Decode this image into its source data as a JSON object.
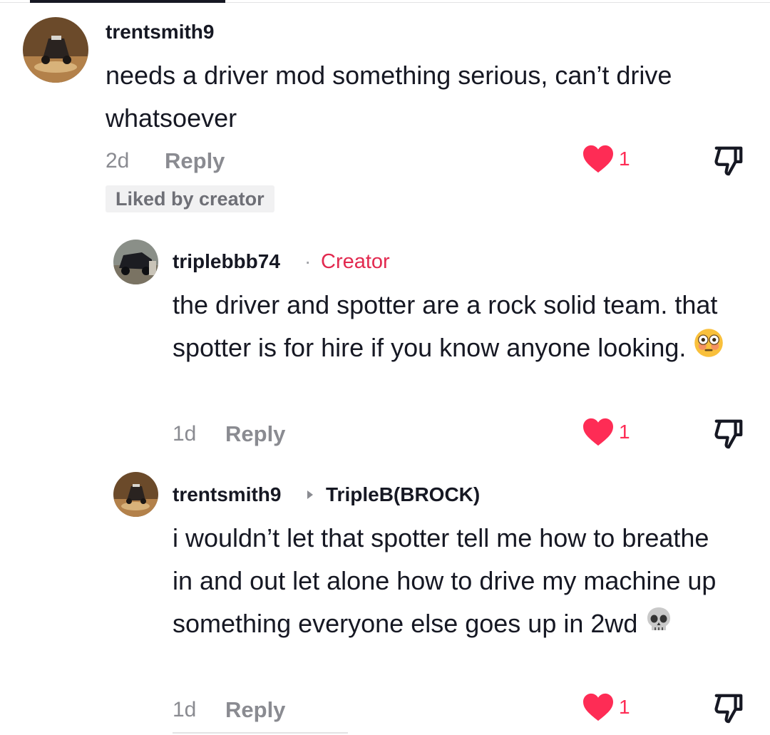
{
  "comments": [
    {
      "username": "trentsmith9",
      "text": "needs a driver mod something serious, can’t drive whatsoever",
      "time": "2d",
      "reply_label": "Reply",
      "likes": "1",
      "liked_by_creator": "Liked by creator",
      "avatar": "offroad-vehicle-photo"
    },
    {
      "username": "triplebbb74",
      "separator": "·",
      "creator_label": "Creator",
      "text": "the driver and spotter are a rock solid team. that spotter is for hire if you know anyone looking.",
      "emoji": "flushed-face-emoji",
      "time": "1d",
      "reply_label": "Reply",
      "likes": "1",
      "avatar": "black-truck-photo"
    },
    {
      "username": "trentsmith9",
      "reply_to": "TripleB(BROCK)",
      "text": "i wouldn’t let that spotter tell me how to breathe in and out let alone how to drive my machine up something everyone else goes up in 2wd",
      "emoji": "skull-emoji",
      "time": "1d",
      "reply_label": "Reply",
      "likes": "1",
      "avatar": "offroad-vehicle-photo"
    }
  ],
  "colors": {
    "like": "#fe2c55",
    "creator": "#e2294f",
    "meta": "#8a8b91",
    "text": "#161823"
  },
  "icons": {
    "like": "heart-icon",
    "dislike": "thumbs-down-icon",
    "reply_to": "caret-right-icon"
  }
}
